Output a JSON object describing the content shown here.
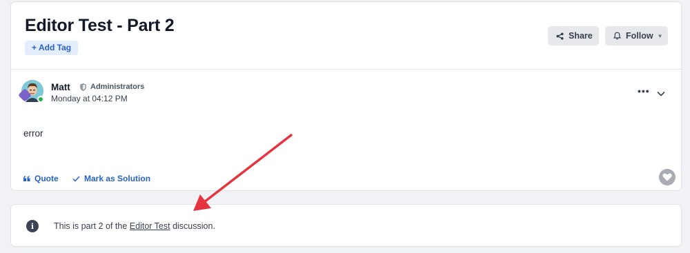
{
  "thread": {
    "title": "Editor Test - Part 2",
    "add_tag_label": "Add Tag",
    "share_label": "Share",
    "follow_label": "Follow"
  },
  "post": {
    "author": "Matt",
    "role": "Administrators",
    "timestamp": "Monday at 04:12 PM",
    "body": "error",
    "more_label": "•••",
    "quote_label": "Quote",
    "solution_label": "Mark as Solution"
  },
  "info_notice": {
    "prefix": "This is part 2 of the ",
    "link_text": "Editor Test",
    "suffix": " discussion."
  },
  "colors": {
    "accent": "#2563c9",
    "annotation_arrow": "#e5343f",
    "online": "#22b14c"
  },
  "icons": {
    "share": "share-icon",
    "follow": "bell-icon",
    "role": "shield-icon",
    "quote": "quote-icon",
    "solution": "checkmark-icon",
    "like": "heart-icon",
    "info": "info-icon"
  }
}
